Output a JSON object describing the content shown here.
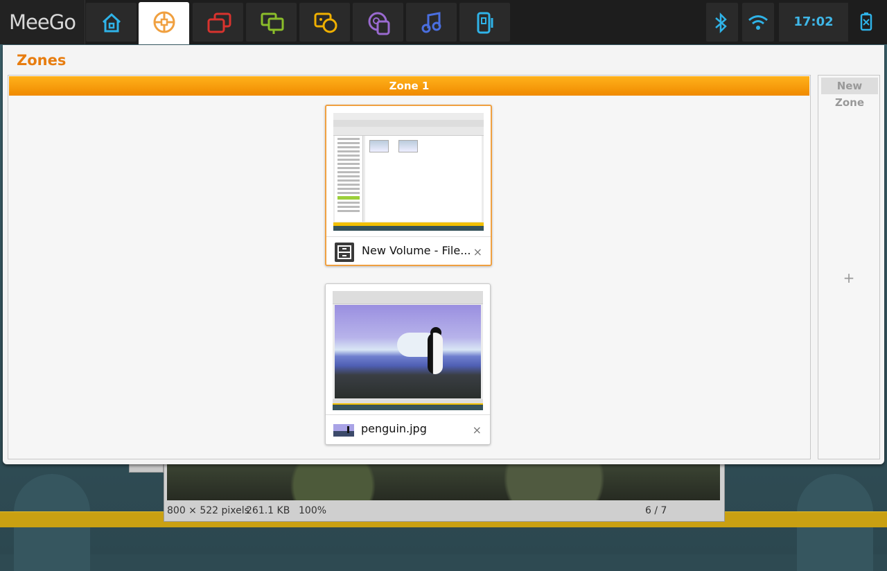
{
  "toolbar": {
    "logo": "MeeGo",
    "clock": "17:02",
    "buttons": [
      {
        "icon": "home-icon",
        "color": "#2fb3e8"
      },
      {
        "icon": "zones-icon",
        "color": "#f0a040",
        "active": true
      },
      {
        "icon": "applications-icon",
        "color": "#d8332e"
      },
      {
        "icon": "status-icon",
        "color": "#8bbd2a"
      },
      {
        "icon": "people-icon",
        "color": "#f0b000"
      },
      {
        "icon": "internet-icon",
        "color": "#9a6ad0"
      },
      {
        "icon": "music-icon",
        "color": "#4a6fe0"
      },
      {
        "icon": "devices-icon",
        "color": "#2fb3e8"
      }
    ],
    "status_icons": [
      "bluetooth-icon",
      "wifi-icon",
      "battery-icon"
    ]
  },
  "zones": {
    "title": "Zones",
    "zone1": {
      "header": "Zone 1",
      "windows": [
        {
          "caption": "New Volume - File...",
          "close": "×",
          "selected": true
        },
        {
          "caption": "penguin.jpg",
          "close": "×",
          "selected": false
        }
      ]
    },
    "new_zone": {
      "header": "New Zone",
      "add": "+"
    }
  },
  "background_window": {
    "status_size": "800 × 522 pixels",
    "status_filesize": "261.1 KB",
    "status_zoom": "100%",
    "status_page": "6 / 7"
  }
}
